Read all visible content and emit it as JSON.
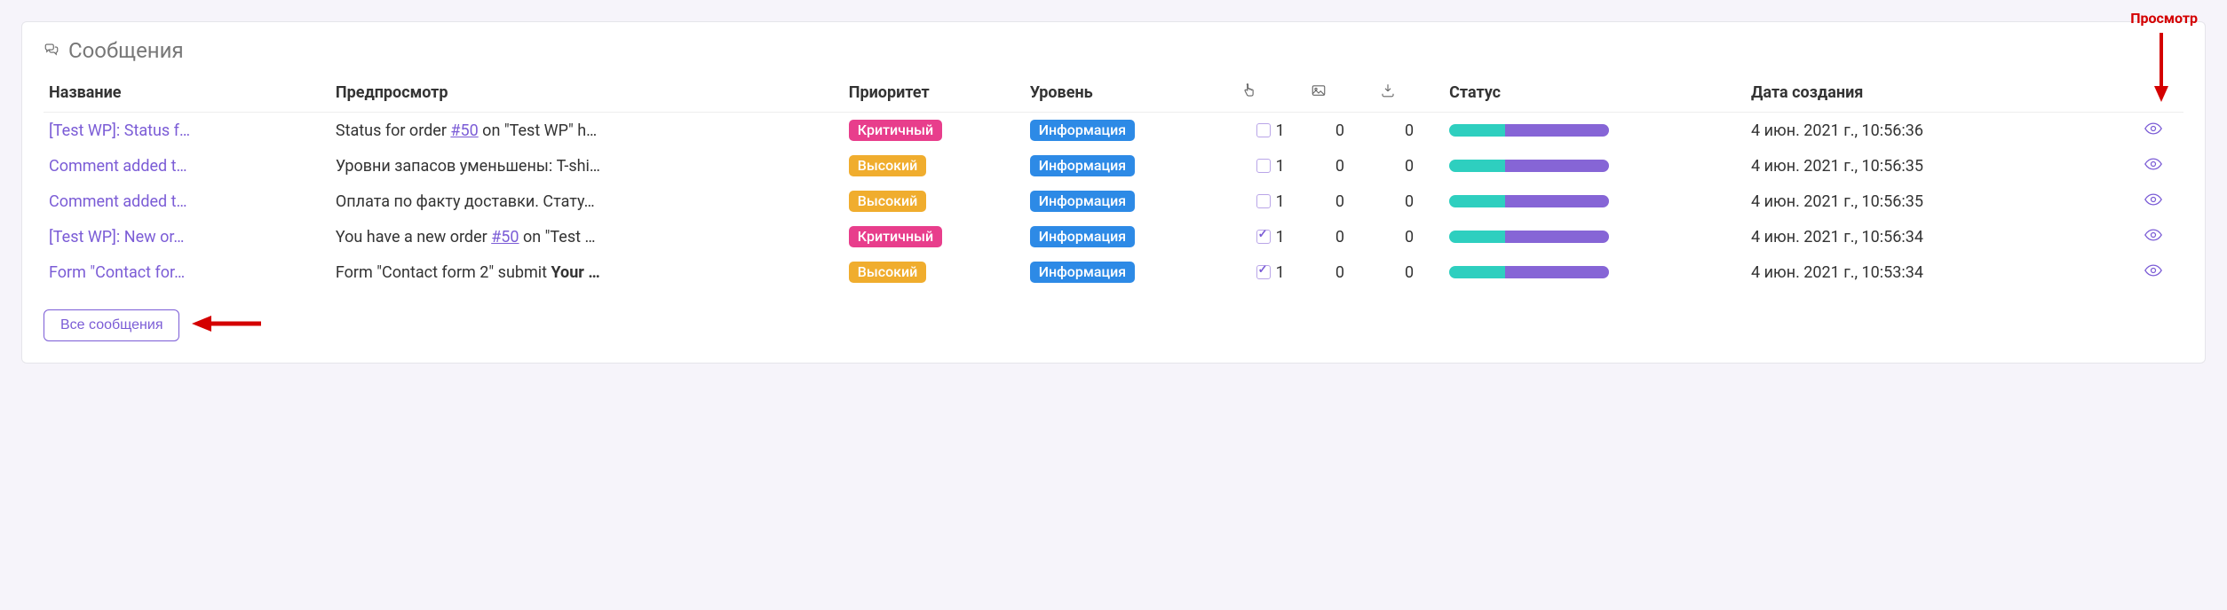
{
  "annotations": {
    "top_label": "Просмотр"
  },
  "panel": {
    "title": "Сообщения"
  },
  "columns": {
    "title": "Название",
    "preview": "Предпросмотр",
    "priority": "Приоритет",
    "level": "Уровень",
    "status": "Статус",
    "created": "Дата создания"
  },
  "badges": {
    "critical": "Критичный",
    "high": "Высокий",
    "info": "Информация"
  },
  "rows": [
    {
      "title": "[Test WP]: Status f…",
      "preview_pre": "Status for order ",
      "preview_link": "#50",
      "preview_post": " on \"Test WP\" h…",
      "priority": "critical",
      "level": "info",
      "clicks": 1,
      "clicks_checked": false,
      "images": 0,
      "downloads": 0,
      "created": "4 июн. 2021 г., 10:56:36"
    },
    {
      "title": "Comment added t…",
      "preview_pre": "Уровни запасов уменьшены: T-shi…",
      "preview_link": "",
      "preview_post": "",
      "priority": "high",
      "level": "info",
      "clicks": 1,
      "clicks_checked": false,
      "images": 0,
      "downloads": 0,
      "created": "4 июн. 2021 г., 10:56:35"
    },
    {
      "title": "Comment added t…",
      "preview_pre": "Оплата по факту доставки. Стату…",
      "preview_link": "",
      "preview_post": "",
      "priority": "high",
      "level": "info",
      "clicks": 1,
      "clicks_checked": false,
      "images": 0,
      "downloads": 0,
      "created": "4 июн. 2021 г., 10:56:35"
    },
    {
      "title": "[Test WP]: New or…",
      "preview_pre": "You have a new order ",
      "preview_link": "#50",
      "preview_post": " on \"Test …",
      "priority": "critical",
      "level": "info",
      "clicks": 1,
      "clicks_checked": true,
      "images": 0,
      "downloads": 0,
      "created": "4 июн. 2021 г., 10:56:34"
    },
    {
      "title": "Form \"Contact for…",
      "preview_pre": "Form \"Contact form 2\" submit ",
      "preview_bold": "Your …",
      "preview_link": "",
      "preview_post": "",
      "priority": "high",
      "level": "info",
      "clicks": 1,
      "clicks_checked": true,
      "images": 0,
      "downloads": 0,
      "created": "4 июн. 2021 г., 10:53:34"
    }
  ],
  "footer": {
    "all_messages": "Все сообщения"
  }
}
